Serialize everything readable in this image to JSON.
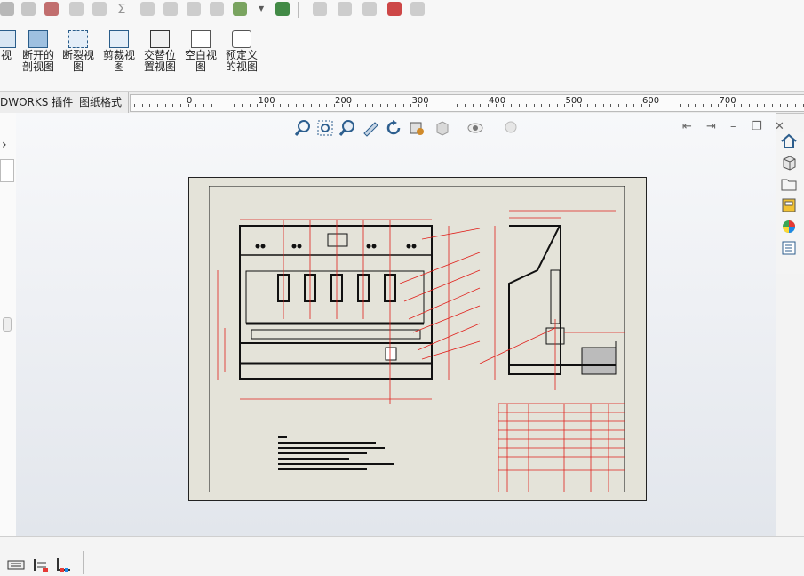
{
  "ribbon": {
    "buttons": [
      {
        "label": "视"
      },
      {
        "label": "断开的\n剖视图"
      },
      {
        "label": "断裂视\n图"
      },
      {
        "label": "剪裁视\n图"
      },
      {
        "label": "交替位\n置视图"
      },
      {
        "label": "空白视\n图"
      },
      {
        "label": "预定义\n的视图"
      }
    ]
  },
  "tabs": [
    {
      "label": "DWORKS 插件"
    },
    {
      "label": "图纸格式"
    }
  ],
  "ruler": {
    "labels": [
      "0",
      "100",
      "200",
      "300",
      "400",
      "500",
      "600",
      "700"
    ]
  },
  "right_panel": {
    "icons": [
      "home-icon",
      "3d-part-icon",
      "folder-icon",
      "view-palette-icon",
      "appearance-icon",
      "properties-icon"
    ]
  },
  "view_toolbar": {
    "icons": [
      "zoom-to-fit-icon",
      "zoom-area-icon",
      "previous-view-icon",
      "section-view-icon",
      "rotate-icon",
      "display-style-icon",
      "view-orientation-icon",
      "hide-show-icon",
      "lighting-icon"
    ]
  },
  "colors": {
    "sheet_bg": "#e4e3d9",
    "drawing_line": "#111111",
    "dimension_red": "#e0201b",
    "canvas": "#eef0f4"
  }
}
